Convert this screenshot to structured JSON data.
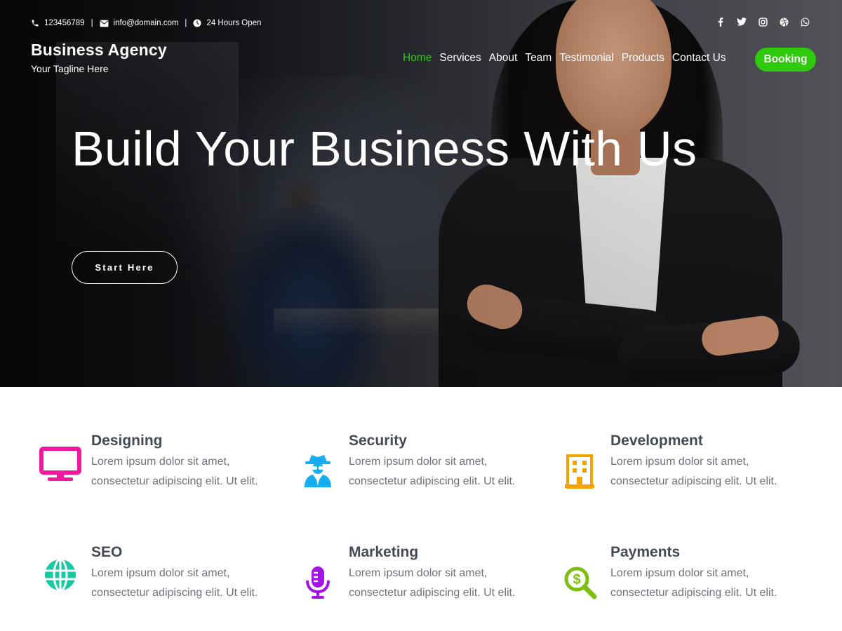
{
  "topbar": {
    "phone": "123456789",
    "email": "info@domain.com",
    "hours": "24 Hours Open",
    "separator": "|"
  },
  "social": [
    "facebook-icon",
    "twitter-icon",
    "instagram-icon",
    "dribbble-icon",
    "whatsapp-icon"
  ],
  "brand": {
    "title": "Business Agency",
    "tagline": "Your Tagline Here"
  },
  "nav": {
    "items": [
      {
        "label": "Home",
        "active": true
      },
      {
        "label": "Services",
        "active": false
      },
      {
        "label": "About",
        "active": false
      },
      {
        "label": "Team",
        "active": false
      },
      {
        "label": "Testimonial",
        "active": false
      },
      {
        "label": "Products",
        "active": false
      },
      {
        "label": "Contact Us",
        "active": false
      }
    ],
    "booking_label": "Booking"
  },
  "hero": {
    "title": "Build Your Business With Us",
    "cta_label": "Start Here"
  },
  "features": [
    {
      "title": "Designing",
      "line1": "Lorem ipsum dolor sit amet,",
      "line2": "consectetur adipiscing elit. Ut elit.",
      "icon": "monitor-icon",
      "color": "#f5179e"
    },
    {
      "title": "Security",
      "line1": "Lorem ipsum dolor sit amet,",
      "line2": "consectetur adipiscing elit. Ut elit.",
      "icon": "user-secret-icon",
      "color": "#16aef0"
    },
    {
      "title": "Development",
      "line1": "Lorem ipsum dolor sit amet,",
      "line2": "consectetur adipiscing elit. Ut elit.",
      "icon": "building-icon",
      "color": "#f5a300"
    },
    {
      "title": "SEO",
      "line1": "Lorem ipsum dolor sit amet,",
      "line2": "consectetur adipiscing elit. Ut elit.",
      "icon": "globe-icon",
      "color": "#16c9a0"
    },
    {
      "title": "Marketing",
      "line1": "Lorem ipsum dolor sit amet,",
      "line2": "consectetur adipiscing elit. Ut elit.",
      "icon": "microphone-icon",
      "color": "#a512e8"
    },
    {
      "title": "Payments",
      "line1": "Lorem ipsum dolor sit amet,",
      "line2": "consectetur adipiscing elit. Ut elit.",
      "icon": "search-dollar-icon",
      "color": "#7cbf0f"
    }
  ],
  "colors": {
    "accent_green": "#2fc90d",
    "heading": "#444a52",
    "body_text": "#6e7278"
  }
}
